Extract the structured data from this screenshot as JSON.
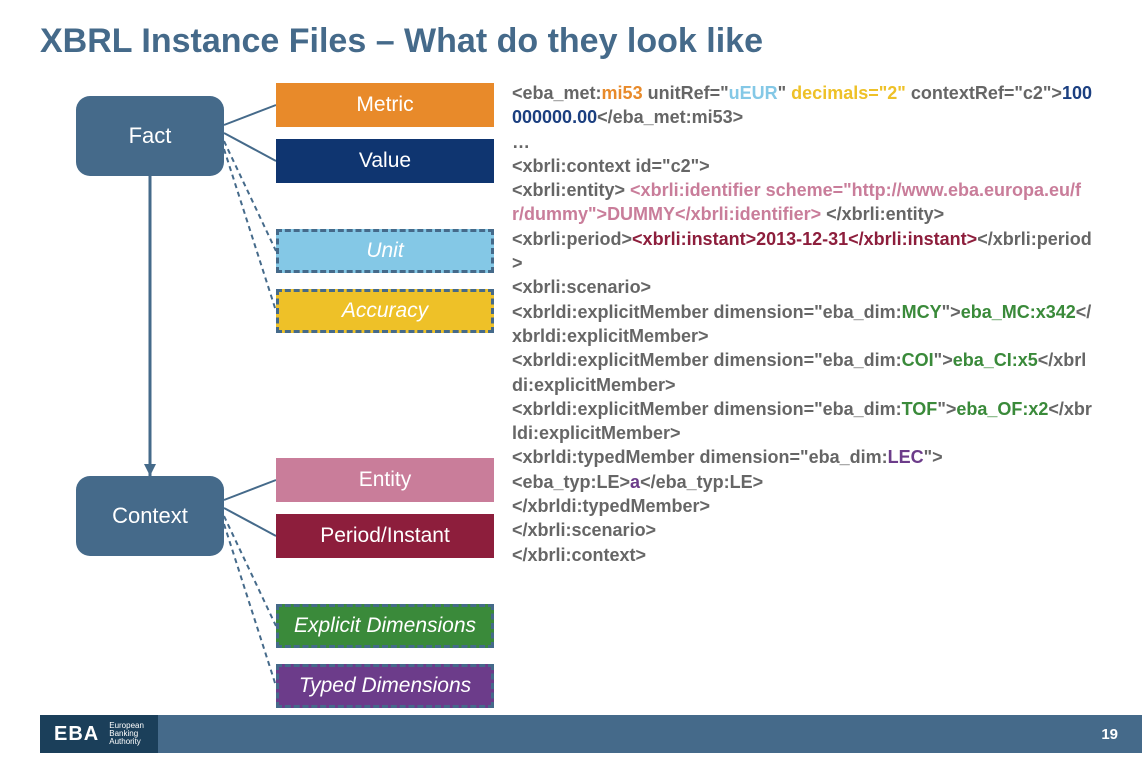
{
  "title": "XBRL Instance Files – What do they look like",
  "diagram": {
    "fact": "Fact",
    "context": "Context",
    "metric": "Metric",
    "value": "Value",
    "unit": "Unit",
    "accuracy": "Accuracy",
    "entity": "Entity",
    "period": "Period/Instant",
    "explicit": "Explicit Dimensions",
    "typed": "Typed Dimensions"
  },
  "code": {
    "l1a": "<eba_met:",
    "l1b": "mi53",
    "l1c": " unitRef=\"",
    "l1d": "uEUR",
    "l1e": "\" ",
    "l1f": "decimals=\"2\"",
    "l1g": " contextRef=\"c2\">",
    "l1h": "100000000.00",
    "l1i": "</eba_met:mi53>",
    "l2": "…",
    "l3": "<xbrli:context id=\"c2\">",
    "l4a": " <xbrli:entity> ",
    "l4b": "<xbrli:identifier scheme=\"http://www.eba.europa.eu/fr/dummy\">DUMMY</xbrli:identifier>",
    "l4c": " </xbrli:entity>",
    "l5a": " <xbrli:period>",
    "l5b": "<xbrli:instant>2013-12-31</xbrli:instant>",
    "l5c": "</xbrli:period>",
    "l6": " <xbrli:scenario>",
    "l7a": "  <xbrldi:explicitMember dimension=\"eba_dim:",
    "l7b": "MCY",
    "l7c": "\">",
    "l7d": "eba_MC:x342",
    "l7e": "</xbrldi:explicitMember>",
    "l8a": "  <xbrldi:explicitMember dimension=\"eba_dim:",
    "l8b": "COI",
    "l8c": "\">",
    "l8d": "eba_CI:x5",
    "l8e": "</xbrldi:explicitMember>",
    "l9a": "  <xbrldi:explicitMember dimension=\"eba_dim:",
    "l9b": "TOF",
    "l9c": "\">",
    "l9d": "eba_OF:x2",
    "l9e": "</xbrldi:explicitMember>",
    "l10a": "<xbrldi:typedMember dimension=\"eba_dim:",
    "l10b": "LEC",
    "l10c": "\">",
    "l11a": "      <eba_typ:LE>",
    "l11b": "a",
    "l11c": "</eba_typ:LE>",
    "l12": "    </xbrldi:typedMember>",
    "l13": " </xbrli:scenario>",
    "l14": "</xbrli:context>"
  },
  "footer": {
    "logo": "EBA",
    "sub1": "European",
    "sub2": "Banking",
    "sub3": "Authority",
    "page": "19"
  }
}
